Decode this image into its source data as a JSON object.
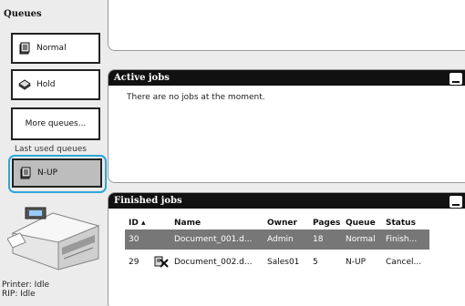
{
  "sidebar": {
    "title": "Queues",
    "queues": [
      {
        "label": "Normal",
        "icon": "stack-icon"
      },
      {
        "label": "Hold",
        "icon": "hold-stack-icon"
      }
    ],
    "more_label": "More queues...",
    "last_used_label": "Last used queues",
    "last_used": [
      {
        "label": "N-UP",
        "icon": "stack-icon"
      }
    ],
    "printer_status": "Printer: Idle",
    "rip_status": "RIP: Idle"
  },
  "active_jobs": {
    "title": "Active jobs",
    "empty_message": "There are no jobs at the moment."
  },
  "finished_jobs": {
    "title": "Finished jobs",
    "columns": {
      "id": "ID ▴",
      "name": "Name",
      "owner": "Owner",
      "pages": "Pages",
      "queue": "Queue",
      "status": "Status"
    },
    "rows": [
      {
        "id": "30",
        "name": "Document_001.d...",
        "owner": "Admin",
        "pages": "18",
        "queue": "Normal",
        "status": "Finish...",
        "selected": true,
        "icon": ""
      },
      {
        "id": "29",
        "name": "Document_002.d...",
        "owner": "Sales01",
        "pages": "5",
        "queue": "N-UP",
        "status": "Cancel...",
        "selected": false,
        "icon": "cancelled-job-icon"
      }
    ]
  },
  "colors": {
    "accent": "#2ba6d9",
    "header": "#111111",
    "selected_row": "#777777",
    "selected_queue": "#bdbdbd"
  }
}
